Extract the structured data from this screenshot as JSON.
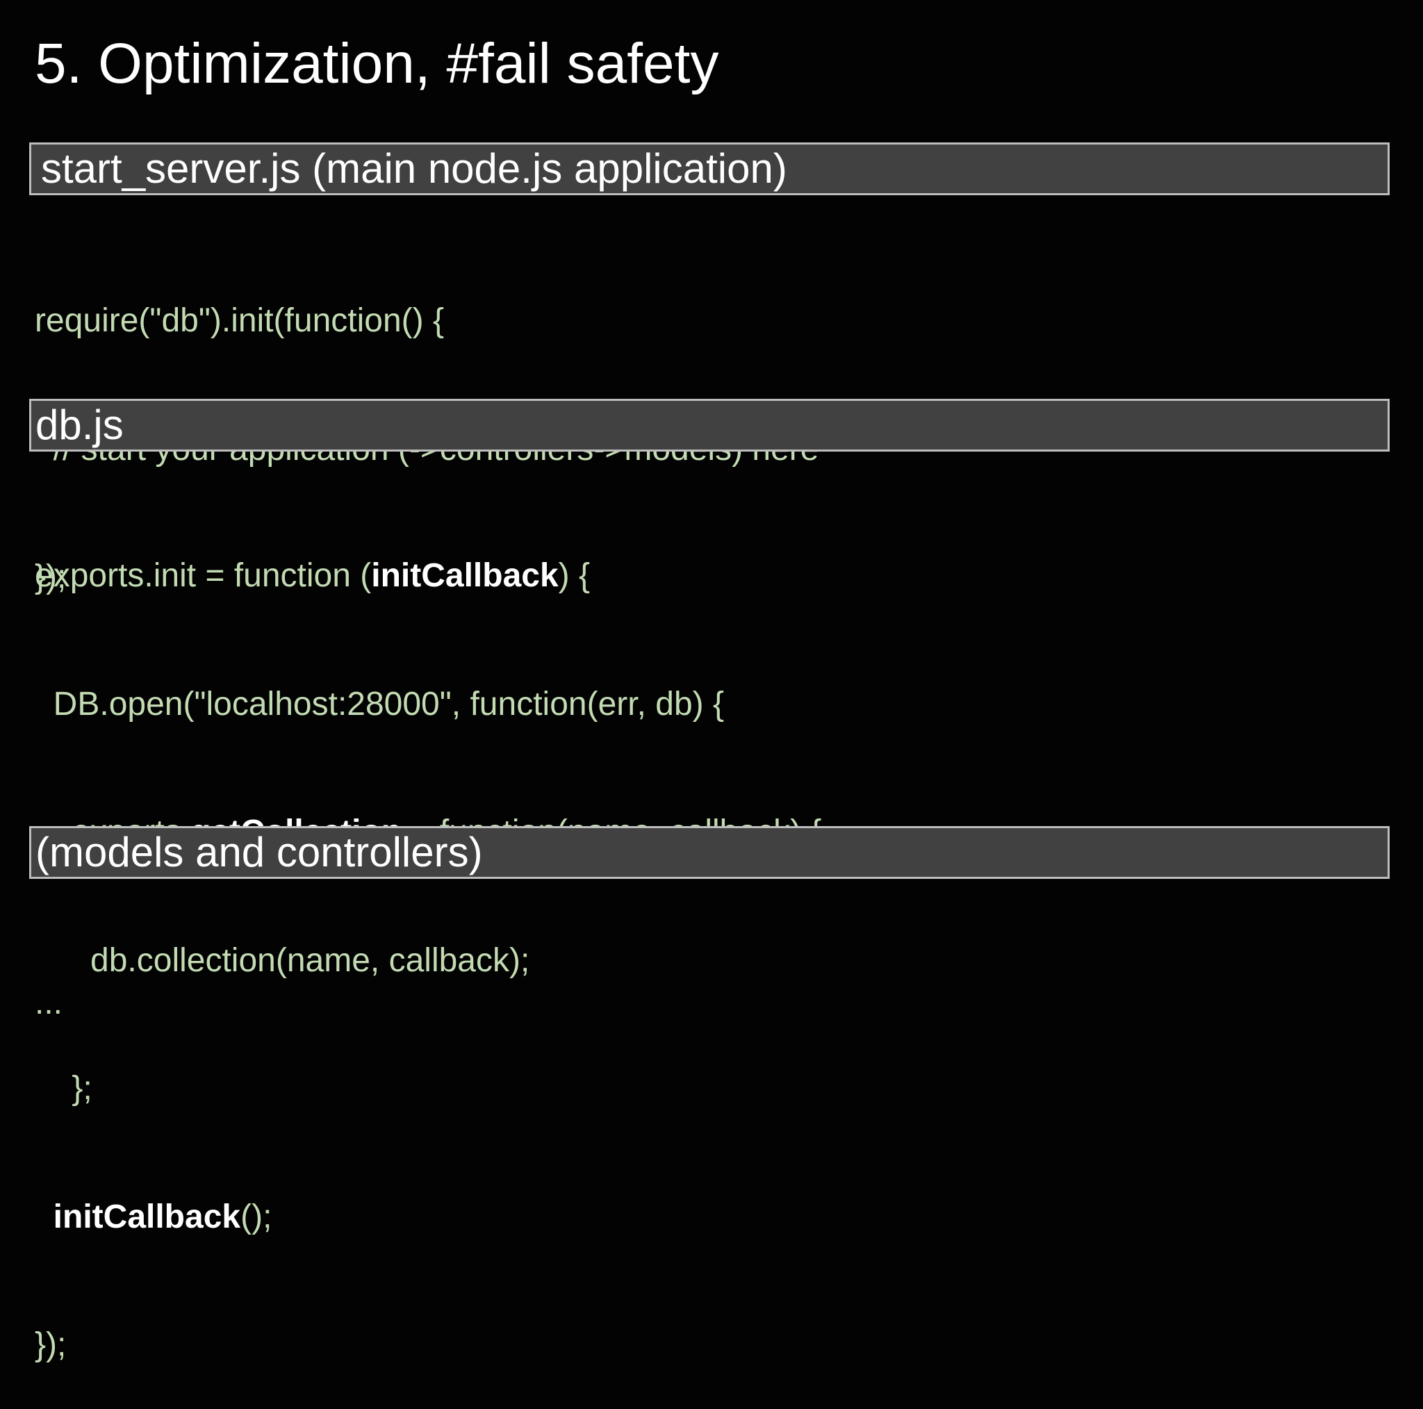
{
  "slide": {
    "title": "5. Optimization, #fail safety"
  },
  "sections": [
    {
      "header": "start_server.js (main node.js application)",
      "lines": [
        [
          "require(\"db\").init(function() {"
        ],
        [
          "  // start your application (->controllers->models) here"
        ],
        [
          "});"
        ]
      ]
    },
    {
      "header": "db.js",
      "lines": [
        [
          "exports.init = function (",
          "initCallback",
          ") {"
        ],
        [
          "  DB.open(\"localhost:28000\", function(err, db) {"
        ],
        [
          "    exports.",
          "getCollection",
          " = function(name, callback) {"
        ],
        [
          "      db.collection(name, callback);"
        ],
        [
          "    };"
        ],
        [
          "  ",
          "initCallback",
          "();"
        ],
        [
          "});"
        ]
      ]
    },
    {
      "header": "(models and controllers)",
      "lines": [
        [
          "..."
        ]
      ]
    }
  ],
  "colors": {
    "background": "#030303",
    "header_fill": "#414141",
    "header_border": "#bdbdbd",
    "code_text": "#c3dbb3",
    "highlight_text": "#ffffff"
  }
}
